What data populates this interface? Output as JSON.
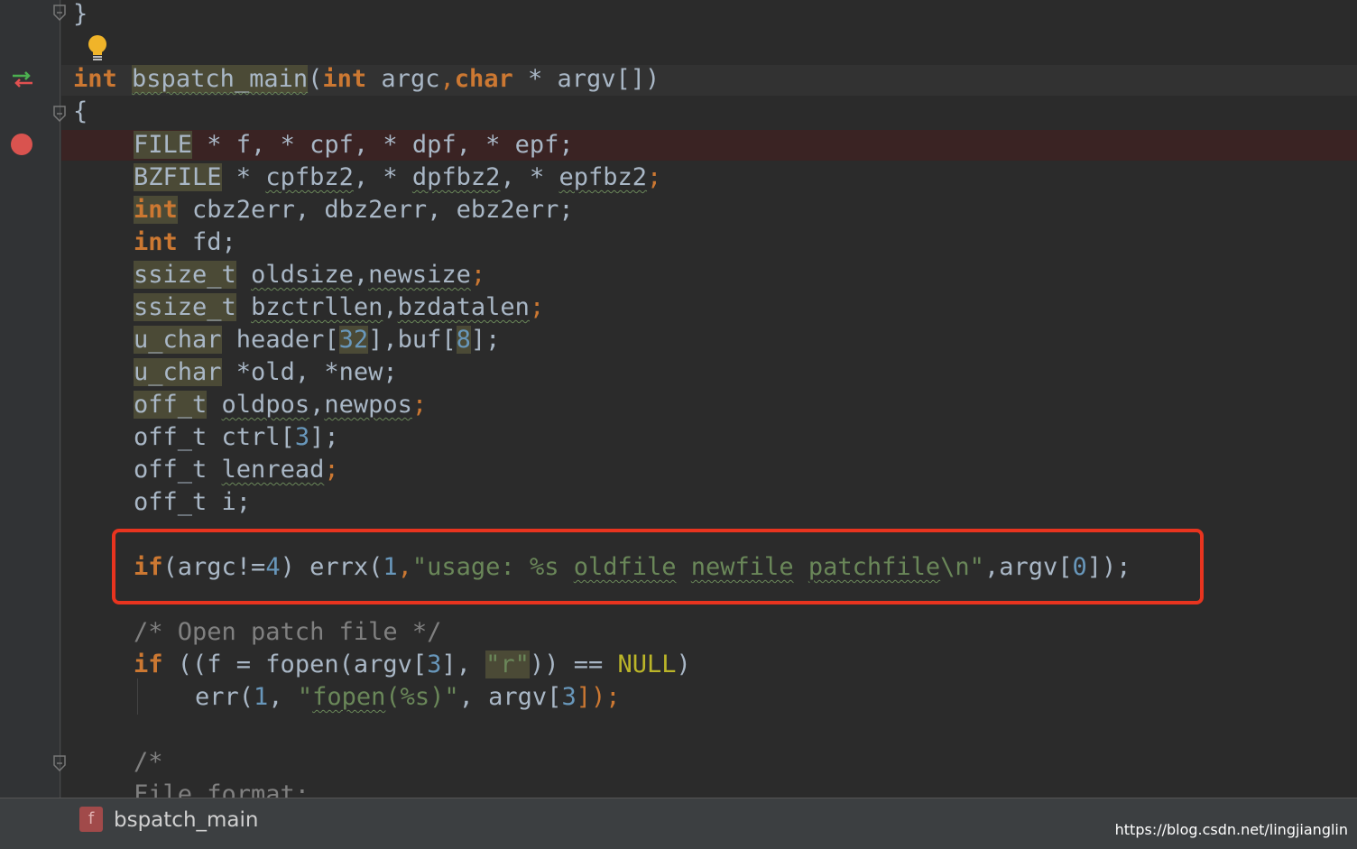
{
  "editor": {
    "colors": {
      "background": "#2b2b2b",
      "keyword": "#cc7832",
      "number": "#6897bb",
      "string": "#6a8759",
      "comment": "#808080",
      "macro": "#bbb529",
      "highlight_box": "#e8341f"
    },
    "lines": {
      "l0_brace": "}",
      "l2_kw": "int",
      "l2_fn": "bspatch_main",
      "l2_p1": "(",
      "l2_kw2": "int",
      "l2_argc": " argc",
      "l2_comma": ",",
      "l2_kw3": "char",
      "l2_rest": " * argv[])",
      "l3_brace": "{",
      "l4_type": "FILE",
      "l4_rest": " * f, * cpf, * dpf, * epf;",
      "l5_type": "BZFILE",
      "l5_a": " * ",
      "l5_v1": "cpfbz2",
      "l5_b": ", * ",
      "l5_v2": "dpfbz2",
      "l5_c": ", * ",
      "l5_v3": "epfbz2",
      "l5_end": ";",
      "l6_kw": "int",
      "l6_rest": " cbz2err, dbz2err, ebz2err;",
      "l7_kw": "int",
      "l7_rest": " fd;",
      "l8_type": "ssize_t",
      "l8_sp": " ",
      "l8_v1": "oldsize",
      "l8_c": ",",
      "l8_v2": "newsize",
      "l8_end": ";",
      "l9_type": "ssize_t",
      "l9_sp": " ",
      "l9_v1": "bzctrllen",
      "l9_c": ",",
      "l9_v2": "bzdatalen",
      "l9_end": ";",
      "l10_type": "u_char",
      "l10_a": " header[",
      "l10_n1": "32",
      "l10_b": "],buf[",
      "l10_n2": "8",
      "l10_end": "];",
      "l11_type": "u_char",
      "l11_rest": " *old, *new;",
      "l12_type": "off_t",
      "l12_sp": " ",
      "l12_v1": "oldpos",
      "l12_c": ",",
      "l12_v2": "newpos",
      "l12_end": ";",
      "l13_a": "off_t ctrl[",
      "l13_n": "3",
      "l13_end": "];",
      "l14_a": "off_t ",
      "l14_v": "lenread",
      "l14_end": ";",
      "l15_a": "off_t i;",
      "l17_kw": "if",
      "l17_a": "(argc!=",
      "l17_n1": "4",
      "l17_b": ") errx(",
      "l17_n2": "1",
      "l17_c": ",",
      "l17_s1": "\"usage: %s ",
      "l17_w1": "oldfile",
      "l17_s2": " ",
      "l17_w2": "newfile",
      "l17_s3": " ",
      "l17_w3": "patchfile",
      "l17_s4": "\\n\"",
      "l17_d": ",argv[",
      "l17_n3": "0",
      "l17_end": "]);",
      "l19_cmt": "/* Open patch file */",
      "l20_kw": "if",
      "l20_a": " ((f = fopen(argv[",
      "l20_n": "3",
      "l20_b": "], ",
      "l20_s": "\"r\"",
      "l20_c": ")) == ",
      "l20_macro": "NULL",
      "l20_end": ")",
      "l21_a": "err(",
      "l21_n1": "1",
      "l21_b": ", ",
      "l21_s1": "\"",
      "l21_w": "fopen",
      "l21_s2": "(%s)\"",
      "l21_c": ", argv[",
      "l21_n2": "3",
      "l21_end": "]);",
      "l23_cmt": "/*",
      "l24_cmt": "File format:"
    }
  },
  "statusbar": {
    "badge": "f",
    "function_name": "bspatch_main",
    "watermark": "https://blog.csdn.net/lingjianglin"
  },
  "icons": {
    "gutter_nav": "implementation-arrows-icon",
    "bulb": "lightbulb-icon",
    "breakpoint": "breakpoint-icon",
    "fold": "fold-marker-icon"
  }
}
